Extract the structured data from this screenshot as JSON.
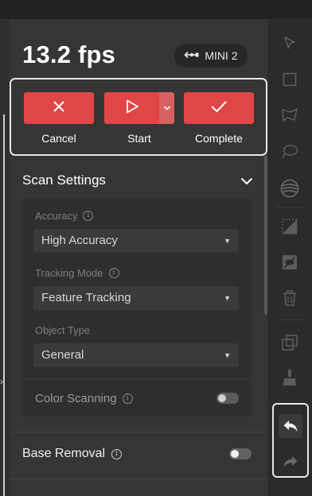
{
  "header": {
    "fps": "13.2 fps",
    "device": {
      "label": "MINI 2",
      "icon": "usb-icon"
    }
  },
  "actions": {
    "cancel": {
      "label": "Cancel",
      "icon": "close-icon"
    },
    "start": {
      "label": "Start",
      "icon": "play-icon",
      "dropdown_icon": "chevron-down-icon"
    },
    "complete": {
      "label": "Complete",
      "icon": "check-icon"
    }
  },
  "scan_settings": {
    "title": "Scan Settings",
    "fields": [
      {
        "label": "Accuracy",
        "value": "High Accuracy"
      },
      {
        "label": "Tracking Mode",
        "value": "Feature Tracking"
      },
      {
        "label": "Object Type",
        "value": "General"
      }
    ],
    "color_scanning": {
      "label": "Color Scanning",
      "enabled": false
    }
  },
  "base_removal": {
    "label": "Base Removal",
    "enabled": false
  },
  "tools": [
    "pointer-icon",
    "rectangle-select-icon",
    "lasso-icon",
    "brush-select-icon",
    "mesh-sphere-icon",
    "invert-selection-icon",
    "hide-icon",
    "delete-icon",
    "copy-icon",
    "cleanup-brush-icon",
    "undo-icon",
    "redo-icon"
  ],
  "colors": {
    "accent": "#e04646",
    "panel": "#353535",
    "card": "#2e2e2e"
  }
}
